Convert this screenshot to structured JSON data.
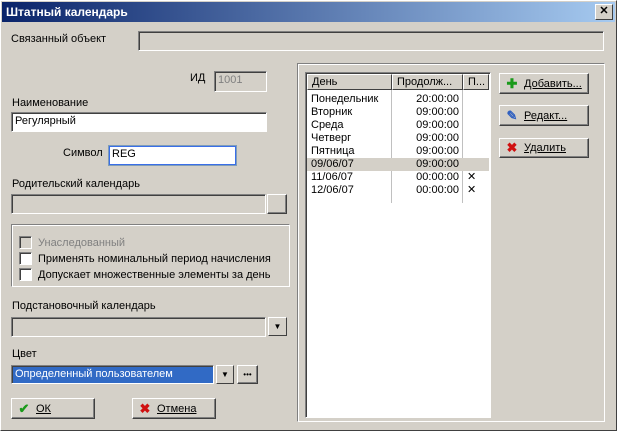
{
  "window": {
    "title": "Штатный календарь",
    "close_label": "✕"
  },
  "linked_object": {
    "label": "Связанный объект",
    "value": ""
  },
  "id_field": {
    "label": "ИД",
    "value": "1001"
  },
  "name_field": {
    "label": "Наименование",
    "value": "Регулярный"
  },
  "symbol_field": {
    "label": "Символ",
    "value": "REG"
  },
  "parent_calendar": {
    "label": "Родительский календарь",
    "value": ""
  },
  "options": {
    "inherited": "Унаследованный",
    "nominal": "Применять номинальный период начисления",
    "multiple": "Допускает множественные элементы за день"
  },
  "substitute_calendar": {
    "label": "Подстановочный календарь",
    "value": ""
  },
  "color": {
    "label": "Цвет",
    "value": "Определенный пользователем",
    "ellipsis": "•••"
  },
  "buttons": {
    "ok": "ОК",
    "cancel": "Отмена",
    "add": "Добавить...",
    "edit": "Редакт...",
    "delete": "Удалить"
  },
  "table": {
    "columns": [
      "День",
      "Продолж...",
      "П..."
    ],
    "rows": [
      {
        "day": "Понедельник",
        "duration": "20:00:00",
        "p": ""
      },
      {
        "day": "Вторник",
        "duration": "09:00:00",
        "p": ""
      },
      {
        "day": "Среда",
        "duration": "09:00:00",
        "p": ""
      },
      {
        "day": "Четверг",
        "duration": "09:00:00",
        "p": ""
      },
      {
        "day": "Пятница",
        "duration": "09:00:00",
        "p": ""
      },
      {
        "day": "09/06/07",
        "duration": "09:00:00",
        "p": ""
      },
      {
        "day": "11/06/07",
        "duration": "00:00:00",
        "p": "✕"
      },
      {
        "day": "12/06/07",
        "duration": "00:00:00",
        "p": "✕"
      }
    ],
    "selected_row": 5
  }
}
